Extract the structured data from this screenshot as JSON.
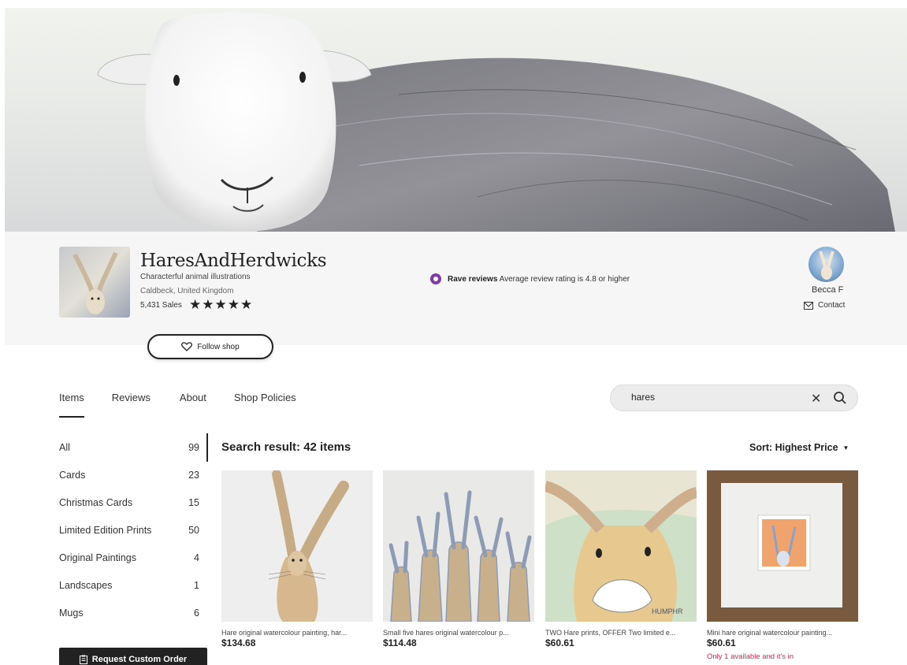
{
  "shop": {
    "name": "HaresAndHerdwicks",
    "tagline": "Characterful animal illustrations",
    "location": "Caldbeck, United Kingdom",
    "sales": "5,431 Sales",
    "rating_stars": 5,
    "stars_text": "★★★★★",
    "rave_label": "Rave reviews",
    "rave_text": "Average review rating is 4.8 or higher",
    "follow_label": "Follow shop"
  },
  "owner": {
    "name": "Becca F",
    "contact_label": "Contact"
  },
  "tabs": [
    {
      "label": "Items",
      "active": true
    },
    {
      "label": "Reviews",
      "active": false
    },
    {
      "label": "About",
      "active": false
    },
    {
      "label": "Shop Policies",
      "active": false
    }
  ],
  "search": {
    "value": "hares",
    "clear_icon": "close-icon",
    "search_icon": "search-icon"
  },
  "categories": [
    {
      "label": "All",
      "count": "99",
      "selected": true
    },
    {
      "label": "Cards",
      "count": "23"
    },
    {
      "label": "Christmas Cards",
      "count": "15"
    },
    {
      "label": "Limited Edition Prints",
      "count": "50"
    },
    {
      "label": "Original Paintings",
      "count": "4"
    },
    {
      "label": "Landscapes",
      "count": "1"
    },
    {
      "label": "Mugs",
      "count": "6"
    }
  ],
  "request_button": "Request Custom Order",
  "results": {
    "title": "Search result: 42 items",
    "sort_label": "Sort: Highest Price"
  },
  "listings": [
    {
      "title": "Hare original watercolour painting, har...",
      "price": "$134.68",
      "stock": ""
    },
    {
      "title": "Small five hares original watercolour p...",
      "price": "$114.48",
      "stock": ""
    },
    {
      "title": "TWO Hare prints, OFFER Two limited e...",
      "price": "$60.61",
      "stock": ""
    },
    {
      "title": "Mini hare original watercolour painting...",
      "price": "$60.61",
      "stock": "Only 1 available and it's in"
    }
  ],
  "colors": {
    "rave_purple": "#7f3aa3",
    "stock_red": "#d7264e",
    "button_dark": "#222222"
  }
}
